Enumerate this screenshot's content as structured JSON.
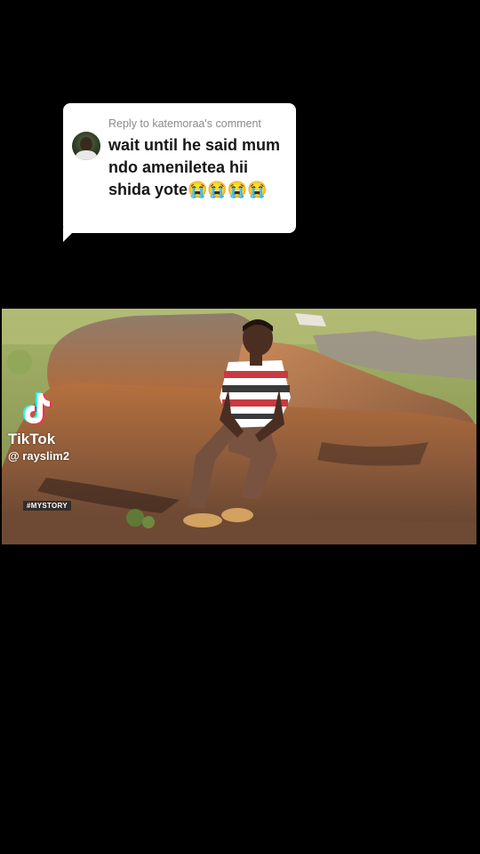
{
  "reply_sticker": {
    "header": "Reply to katemoraa's comment",
    "text": "wait until he said mum ndo ameniletea hii shida yote😭😭😭😭"
  },
  "watermark": {
    "brand": "TikTok",
    "handle": "@ rayslim2"
  },
  "video": {
    "tag": "#MYSTORY"
  },
  "colors": {
    "background": "#000000",
    "sticker_bg": "#ffffff",
    "sticker_text": "#161616",
    "sticker_header": "#8a8a8a",
    "tiktok_cyan": "#25f4ee",
    "tiktok_red": "#fe2c55"
  },
  "icons": {
    "tiktok_logo": "tiktok-note-icon"
  }
}
